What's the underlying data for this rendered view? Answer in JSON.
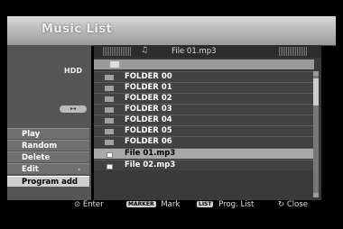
{
  "title": "Music List",
  "left_panel": {
    "source_label": "HDD",
    "transfer_icon": "transfer-icon",
    "menu": [
      {
        "label": "Play",
        "active": false
      },
      {
        "label": "Random",
        "active": false
      },
      {
        "label": "Delete",
        "active": false
      },
      {
        "label": "Edit",
        "active": false,
        "arrow": "›"
      },
      {
        "label": "Program add",
        "active": true
      }
    ]
  },
  "list": {
    "header_icon": "music-note-icon",
    "header_file": "File 01.mp3",
    "parent_icon": "parent-folder-icon",
    "rows": [
      {
        "type": "folder",
        "label": "FOLDER 00"
      },
      {
        "type": "folder",
        "label": "FOLDER 01"
      },
      {
        "type": "folder",
        "label": "FOLDER 02"
      },
      {
        "type": "folder",
        "label": "FOLDER 03"
      },
      {
        "type": "folder",
        "label": "FOLDER 04"
      },
      {
        "type": "folder",
        "label": "FOLDER 05"
      },
      {
        "type": "folder",
        "label": "FOLDER 06"
      },
      {
        "type": "file",
        "label": "File 01.mp3",
        "selected": true
      },
      {
        "type": "file",
        "label": "File 02.mp3",
        "selected": false
      }
    ]
  },
  "bottom_bar": {
    "enter": {
      "symbol": "⊙",
      "label": "Enter"
    },
    "mark": {
      "key": "MARKER",
      "label": "Mark"
    },
    "prog_list": {
      "key": "LIST",
      "label": "Prog. List"
    },
    "close": {
      "symbol": "↻",
      "label": "Close"
    }
  }
}
